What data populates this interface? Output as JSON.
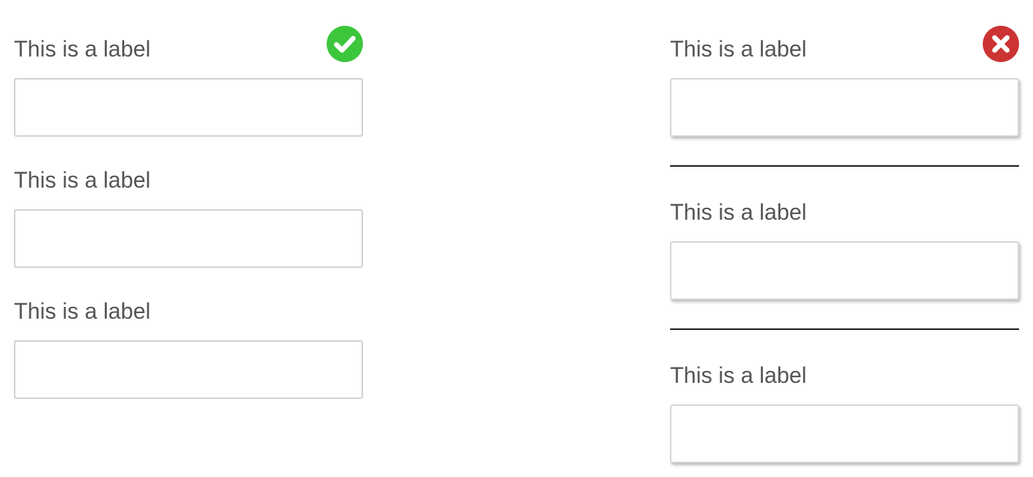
{
  "colors": {
    "success": "#3cc63c",
    "error": "#cc3333",
    "label_text": "#555555",
    "input_border": "#cfcfcf",
    "divider": "#111111"
  },
  "left_column": {
    "fields": [
      {
        "label": "This is a label",
        "value": "",
        "status_icon": "check-circle-icon"
      },
      {
        "label": "This is a label",
        "value": ""
      },
      {
        "label": "This is a label",
        "value": ""
      }
    ]
  },
  "right_column": {
    "fields": [
      {
        "label": "This is a label",
        "value": "",
        "status_icon": "x-circle-icon"
      },
      {
        "label": "This is a label",
        "value": ""
      },
      {
        "label": "This is a label",
        "value": ""
      }
    ]
  }
}
